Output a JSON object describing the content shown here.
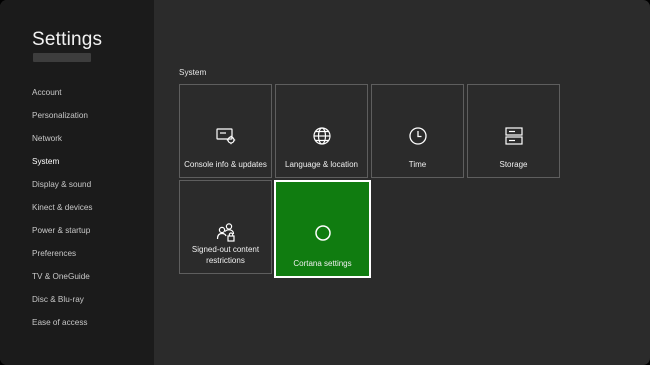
{
  "sidebar": {
    "title": "Settings",
    "items": [
      {
        "label": "Account"
      },
      {
        "label": "Personalization"
      },
      {
        "label": "Network"
      },
      {
        "label": "System",
        "active": true
      },
      {
        "label": "Display & sound"
      },
      {
        "label": "Kinect & devices"
      },
      {
        "label": "Power & startup"
      },
      {
        "label": "Preferences"
      },
      {
        "label": "TV & OneGuide"
      },
      {
        "label": "Disc & Blu-ray"
      },
      {
        "label": "Ease of access"
      }
    ]
  },
  "main": {
    "section_label": "System",
    "tiles": [
      {
        "label": "Console info & updates",
        "icon": "console-info-icon"
      },
      {
        "label": "Language & location",
        "icon": "globe-icon"
      },
      {
        "label": "Time",
        "icon": "clock-icon"
      },
      {
        "label": "Storage",
        "icon": "storage-icon"
      },
      {
        "label": "Signed-out content restrictions",
        "icon": "people-lock-icon"
      },
      {
        "label": "Cortana settings",
        "icon": "cortana-circle-icon",
        "selected": true
      }
    ]
  },
  "colors": {
    "sidebar_bg": "#1b1b1b",
    "main_bg": "#2b2b2b",
    "tile_border": "#5e5e5e",
    "selected_accent": "#107c10"
  }
}
